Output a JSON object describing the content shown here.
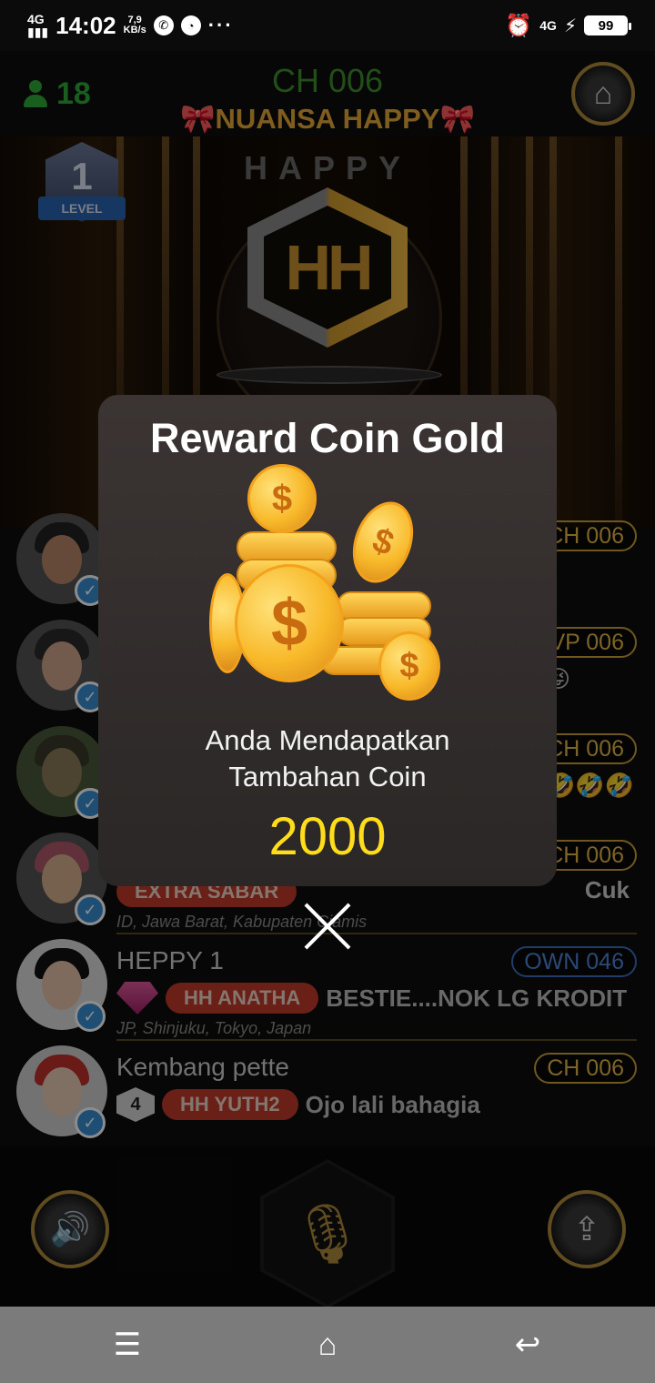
{
  "status_bar": {
    "network_left": "4G",
    "time": "14:02",
    "speed_value": "7,9",
    "speed_unit": "KB/s",
    "network_right": "4G",
    "battery": "99"
  },
  "header": {
    "user_count": "18",
    "channel": "CH 006",
    "room_name": "NUANSA HAPPY"
  },
  "stage": {
    "level_number": "1",
    "level_label": "LEVEL",
    "title": "HAPPY",
    "logo_text": "HH"
  },
  "members": [
    {
      "name": "",
      "chip": "CH 006",
      "chip_style": "gold",
      "rank": "",
      "tag": "",
      "message": "",
      "location": ""
    },
    {
      "name": "",
      "chip": "VP 006",
      "chip_style": "gold",
      "rank": "",
      "tag": "",
      "message": "😝",
      "location": ""
    },
    {
      "name": "",
      "chip": "CH 006",
      "chip_style": "gold",
      "rank": "",
      "tag": "",
      "message": "🤣🤣🤣",
      "location": ""
    },
    {
      "name": "",
      "chip": "CH 006",
      "chip_style": "gold",
      "rank": "",
      "tag": "EXTRA SABAR",
      "message": "Cuk",
      "location": "ID, Jawa Barat, Kabupaten Ciamis"
    },
    {
      "name": "HEPPY 1",
      "chip": "OWN 046",
      "chip_style": "blue",
      "rank": "",
      "tag": "HH ANATHA",
      "message": "BESTIE....NOK LG KRODIT NGU",
      "location": "JP, Shinjuku, Tokyo, Japan"
    },
    {
      "name": "Kembang pette",
      "chip": "CH 006",
      "chip_style": "gold",
      "rank": "4",
      "tag": "HH  YUTH2",
      "message": "Ojo lali bahagia",
      "location": ""
    }
  ],
  "modal": {
    "title": "Reward Coin Gold",
    "line1": "Anda Mendapatkan",
    "line2": "Tambahan Coin",
    "amount": "2000"
  },
  "colors": {
    "accent_gold": "#e6b847",
    "amount_yellow": "#ffdd1a",
    "user_green": "#2fa93a"
  },
  "icons": {
    "sound": "speaker-icon",
    "mic": "microphone-icon",
    "upload": "upload-icon",
    "home": "home-icon"
  }
}
